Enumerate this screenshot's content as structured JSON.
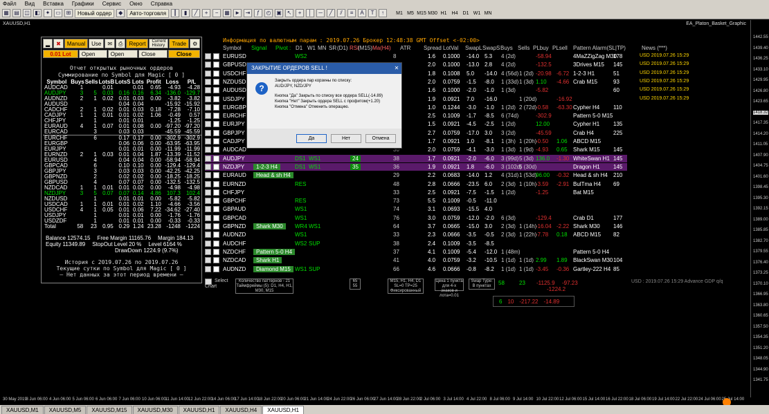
{
  "menu": [
    "Файл",
    "Вид",
    "Вставка",
    "Графики",
    "Сервис",
    "Окно",
    "Справка"
  ],
  "toolbar": {
    "new_order": "Новый ордер",
    "autotrade": "Авто-торговля",
    "timeframes": [
      "M1",
      "M5",
      "M15",
      "M30",
      "H1",
      "H4",
      "D1",
      "W1",
      "MN"
    ]
  },
  "chart": {
    "title": "XAUUSD,H1",
    "ea": "EA_Platon_Basket_Graphic"
  },
  "left_panel": {
    "buttons": [
      "Manual",
      "Use",
      "Report",
      "Current History",
      "Trade"
    ],
    "lot": "0.01 Lot",
    "open_buy": "Open BUY",
    "open_sell": "Open SELL",
    "close_buy": "Close BUY",
    "close_sell": "Close SELL",
    "title1": "Отчет открытых рыночных ордеров",
    "title2": "Суммирование по Symbol для Magic [ 0 ]",
    "headers": [
      "Symbol",
      "Buys",
      "Sells",
      "LotsB",
      "LotsS",
      "Lots",
      "Profit",
      "Loss",
      "P/L"
    ],
    "rows": [
      [
        "AUDCAD",
        "1",
        "",
        "0.01",
        "",
        "0.01",
        "0.65",
        "-4.93",
        "-4.28"
      ],
      [
        "AUDJPY",
        "3",
        "5",
        "0.03",
        "0.16",
        "0.16",
        "6.34",
        "-136.0",
        "-129.7"
      ],
      [
        "AUDNZD",
        "2",
        "1",
        "0.02",
        "0.01",
        "0.03",
        "0.00",
        "-3.82",
        "-3.82"
      ],
      [
        "AUDUSD",
        "",
        "",
        "",
        "0.04",
        "0.04",
        "",
        "-15.92",
        "-15.92"
      ],
      [
        "CADCHF",
        "2",
        "1",
        "0.02",
        "0.01",
        "0.03",
        "0.18",
        "-7.28",
        "-7.10"
      ],
      [
        "CADJPY",
        "1",
        "1",
        "0.01",
        "0.01",
        "0.02",
        "1.06",
        "-0.49",
        "0.57"
      ],
      [
        "CHFJPY",
        "",
        "1",
        "",
        "0.01",
        "0.01",
        "",
        "-1.25",
        "-1.25"
      ],
      [
        "EURAUD",
        "4",
        "1",
        "0.07",
        "0.01",
        "0.08",
        "0.00",
        "-97.20",
        "-97.20"
      ],
      [
        "EURCAD",
        "",
        "3",
        "",
        "0.03",
        "0.03",
        "",
        "-45.59",
        "-45.59"
      ],
      [
        "EURCHF",
        "",
        "6",
        "",
        "0.17",
        "0.17",
        "0.00",
        "-302.9",
        "-302.9"
      ],
      [
        "EURGBP",
        "",
        "",
        "",
        "0.06",
        "0.06",
        "0.00",
        "-63.95",
        "-63.95"
      ],
      [
        "EURJPY",
        "",
        "",
        "",
        "0.01",
        "0.01",
        "0.00",
        "-11.99",
        "-11.99"
      ],
      [
        "EURNZD",
        "2",
        "1",
        "0.03",
        "0.01",
        "0.04",
        "1.87",
        "-13.39",
        "-11.52"
      ],
      [
        "EURUSD",
        "",
        "4",
        "",
        "0.04",
        "0.04",
        "0.00",
        "-58.94",
        "-58.94"
      ],
      [
        "GBPCAD",
        "",
        "6",
        "",
        "0.10",
        "0.10",
        "0.00",
        "-129.4",
        "-129.4"
      ],
      [
        "GBPJPY",
        "",
        "3",
        "",
        "0.03",
        "0.03",
        "0.00",
        "-42.25",
        "-42.25"
      ],
      [
        "GBPNZD",
        "",
        "2",
        "",
        "0.02",
        "0.02",
        "0.00",
        "-18.25",
        "-18.25"
      ],
      [
        "GBPUSD",
        "",
        "4",
        "",
        "0.07",
        "0.07",
        "0.00",
        "-132.5",
        "-132.5"
      ],
      [
        "NZDCAD",
        "1",
        "1",
        "0.01",
        "0.01",
        "0.02",
        "0.00",
        "-4.98",
        "-4.98"
      ],
      [
        "NZDJPY",
        "3",
        "5",
        "0.07",
        "0.07",
        "0.14",
        "4.86",
        "107.3",
        "102.4"
      ],
      [
        "NZDUSD",
        "",
        "1",
        "",
        "0.01",
        "0.01",
        "0.00",
        "-5.82",
        "-5.82"
      ],
      [
        "USDCAD",
        "1",
        "1",
        "0.01",
        "0.01",
        "0.02",
        "1.10",
        "-4.66",
        "-3.56"
      ],
      [
        "USDCHF",
        "4",
        "1",
        "0.05",
        "0.01",
        "0.06",
        "7.22",
        "-34.62",
        "-27.40"
      ],
      [
        "USDJPY",
        "",
        "1",
        "",
        "0.01",
        "0.01",
        "0.00",
        "-1.76",
        "-1.76"
      ],
      [
        "USDZDF",
        "",
        "1",
        "",
        "0.01",
        "0.01",
        "0.00",
        "-0.33",
        "-0.33"
      ],
      [
        "Total",
        "58",
        "23",
        "0.95",
        "0.29",
        "1.24",
        "23.28",
        "-1248",
        "-1224"
      ]
    ],
    "green_rows": [
      1,
      19
    ],
    "balance": "Balance 12574.15",
    "free_margin": "Free Margin 11165.76",
    "margin": "Margin 184.13",
    "equity": "Equity 11349.89",
    "stopout": "StopOut Level 20 %",
    "level": "Level 6164 %",
    "drawdown": "DrawDown 1224.9 (9.7%)",
    "hist1": "История с 2019.07.26 по 2019.07.26",
    "hist2": "Текущие сутки по Symbol для Magic [ 0 ]",
    "hist3": "— Нет данных за этот период времени —"
  },
  "info": {
    "line": "Информация по валютным парам : 2019.07.26   Брокер 12:48:38  GMT Offset <-02:00>"
  },
  "grid_headers": [
    "Symbol",
    "Signal",
    "Pivot :",
    "D1",
    "W1",
    "MN",
    "SR",
    "(D1)",
    "RSI",
    "(M15)",
    "Ma(H4)",
    "ATR",
    "Spread",
    "LotVal",
    "SwapL",
    "SwapS",
    "Buys",
    "Sells",
    "PLbuy",
    "PLsell",
    "Pattern Alarm(SL|TP)",
    "News (***)"
  ],
  "grid_rows": [
    {
      "sym": "EURUSD",
      "sig": "",
      "d1": "WS2",
      "atr": "8",
      "spread": "1.6",
      "lotval": "0.1000",
      "swapl": "-14.0",
      "swaps": "5.3",
      "buys": "4 (2d)",
      "sells": "",
      "plb": "-58.94",
      "pls": "",
      "pat": "4MaZZigZag M30",
      "num": "178",
      "news": "USD 2019.07.26 15:29"
    },
    {
      "sym": "GBPUSD",
      "d1": "",
      "atr": "27",
      "spread": "2.0",
      "lotval": "0.1000",
      "swapl": "-13.0",
      "swaps": "2.8",
      "buys": "4 (2d)",
      "plb": "-132.5",
      "pat": "3Drives M15",
      "num": "145",
      "news": "USD 2019.07.26 15:29"
    },
    {
      "sym": "USDCHF",
      "d1": "",
      "atr": "18",
      "spread": "1.8",
      "lotval": "0.1008",
      "swapl": "5.0",
      "swaps": "-14.0",
      "buys": "4 (56d)",
      "sells": "1 (2d)",
      "plb": "-20.98",
      "pls": "-6.72",
      "pat": "1-2-3 H1",
      "num": "51",
      "news": "USD 2019.07.26 15:29"
    },
    {
      "sym": "NZDUSD",
      "d1": "",
      "atr": "57",
      "spread": "2.0",
      "lotval": "0.0759",
      "swapl": "-1.5",
      "swaps": "-8.0",
      "buys": "1 (33d)",
      "sells": "1 (3d)",
      "plb": "1.10",
      "pls": "-4.66",
      "pat": "Crab M15",
      "num": "93",
      "news": "USD 2019.07.26 15:29"
    },
    {
      "sym": "AUDUSD",
      "d1": "",
      "atr": "18",
      "spread": "1.6",
      "lotval": "0.1000",
      "swapl": "-2.0",
      "swaps": "-1.0",
      "buys": "1 (3d)",
      "plb": "-5.82",
      "pat": "",
      "num": "60",
      "news": "USD 2019.07.26 15:29"
    },
    {
      "sym": "USDJPY",
      "d1": "",
      "atr": "48",
      "spread": "1.9",
      "lotval": "0.0921",
      "swapl": "7.0",
      "swaps": "-16.0",
      "buys": "",
      "sells": "1 (20d)",
      "plb": "",
      "pls": "-16.92",
      "pat": "",
      "num": "",
      "news": "USD 2019.07.26 15:29"
    },
    {
      "sym": "EURGBP",
      "d1": "",
      "atr": "40",
      "spread": "1.0",
      "lotval": "0.1244",
      "swapl": "-3.0",
      "swaps": "-1.0",
      "buys": "1 (2d)",
      "sells": "2 (72d)",
      "plb": "-0.58",
      "pls": "-63.30",
      "pat": "Cypher H4",
      "num": "110",
      "news": ""
    },
    {
      "sym": "EURCHF",
      "d1": "",
      "atr": "19",
      "spread": "2.5",
      "lotval": "0.1009",
      "swapl": "-1.7",
      "swaps": "-8.5",
      "buys": "6 (74d)",
      "plb": "-302.9",
      "pat": "Pattern 5-0 M15",
      "num": "",
      "news": ""
    },
    {
      "sym": "EURJPY",
      "d1": "",
      "atr": "53",
      "spread": "1.5",
      "lotval": "0.0921",
      "swapl": "-4.5",
      "swaps": "-2.5",
      "buys": "1 (2d)",
      "plb": "12.00",
      "pat": "Cypher H1",
      "num": "135",
      "news": ""
    },
    {
      "sym": "GBPJPY",
      "d1": "",
      "atr": "86",
      "spread": "2.7",
      "lotval": "0.0759",
      "swapl": "-17.0",
      "swaps": "3.0",
      "buys": "3 (2d)",
      "plb": "-45.59",
      "pat": "Crab H4",
      "num": "225",
      "news": ""
    },
    {
      "sym": "CADJPY",
      "d1": "",
      "atr": "85",
      "spread": "1.7",
      "lotval": "0.0921",
      "swapl": "1.0",
      "swaps": "-8.1",
      "buys": "1 (3h)",
      "sells": "1 (20h)",
      "plb": "-0.50",
      "pls": "1.06",
      "pat": "ABCD M15",
      "num": "",
      "news": ""
    },
    {
      "sym": "AUDCAD",
      "d1": "",
      "atr": "30",
      "spread": "2.0",
      "lotval": "0.0759",
      "swapl": "-4.1",
      "swaps": "-3.0",
      "buys": "1 (3d)",
      "sells": "1 (9d)",
      "plb": "-4.93",
      "pls": "0.65",
      "pat": "Shark M15",
      "num": "145",
      "news": ""
    },
    {
      "sym": "AUDJPY",
      "d1": "DS1",
      "w1": "WS1",
      "rsi": "24",
      "atr": "38",
      "spread": "1.7",
      "lotval": "0.0921",
      "swapl": "-2.0",
      "swaps": "-6.0",
      "buys": "3 (99d)",
      "sells": "5 (3d)",
      "plb": "136.0",
      "pls": "-1.30",
      "pat": "WhiteSwan H1",
      "num": "145",
      "hl": "p"
    },
    {
      "sym": "NZDJPY",
      "sig": "1-2-3 H4",
      "d1": "DS1",
      "w1": "WS1",
      "rsi": "35",
      "atr": "36",
      "spread": "1.9",
      "lotval": "0.0921",
      "swapl": "1.8",
      "swaps": "-6.0",
      "buys": "3 (102d)",
      "sells": "5 (30d)",
      "plb": "",
      "pls": "",
      "pat": "Dragon H1",
      "num": "145",
      "hl": "p"
    },
    {
      "sym": "EURAUD",
      "sig": "Head & sh H4",
      "d1": "",
      "atr": "29",
      "spread": "2.2",
      "lotval": "0.0683",
      "swapl": "-14.0",
      "swaps": "1.2",
      "buys": "4 (31d)",
      "sells": "1 (53d)",
      "plb": "96.00",
      "pls": "-0.32",
      "pat": "Head & sh H4",
      "num": "210"
    },
    {
      "sym": "EURNZD",
      "d1": "RES",
      "atr": "48",
      "spread": "2.8",
      "lotval": "0.0666",
      "swapl": "-23.5",
      "swaps": "6.0",
      "buys": "2 (3d)",
      "sells": "1 (10h)",
      "plb": "-3.59",
      "pls": "-2.91",
      "pat": "BulTma H4",
      "num": "69"
    },
    {
      "sym": "CHFJPY",
      "d1": "",
      "atr": "33",
      "spread": "2.5",
      "lotval": "0.0921",
      "swapl": "-7.5",
      "swaps": "-1.5",
      "buys": "1 (2d)",
      "plb": "-1.25",
      "pat": "Bat M15",
      "num": ""
    },
    {
      "sym": "GBPCHF",
      "d1": "RES",
      "atr": "73",
      "spread": "5.5",
      "lotval": "0.1009",
      "swapl": "-0.5",
      "swaps": "-11.0",
      "buys": "",
      "plb": "",
      "pat": "",
      "num": ""
    },
    {
      "sym": "GBPAUD",
      "d1": "WS1",
      "atr": "74",
      "spread": "3.1",
      "lotval": "0.0693",
      "swapl": "-15.5",
      "swaps": "4.0",
      "buys": "",
      "plb": "",
      "pat": "",
      "num": ""
    },
    {
      "sym": "GBPCAD",
      "d1": "WS1",
      "atr": "76",
      "spread": "3.0",
      "lotval": "0.0759",
      "swapl": "-12.0",
      "swaps": "-2.0",
      "buys": "6 (3d)",
      "plb": "-129.4",
      "pat": "Crab D1",
      "num": "177"
    },
    {
      "sym": "GBPNZD",
      "sig": "Shark M30",
      "d1": "WR4",
      "w1": "WS1",
      "atr": "64",
      "spread": "3.7",
      "lotval": "0.0665",
      "swapl": "-15.0",
      "swaps": "3.0",
      "buys": "2 (3d)",
      "sells": "1 (14h)",
      "plb": "-16.04",
      "pls": "-2.22",
      "pat": "Shark M30",
      "num": "146"
    },
    {
      "sym": "AUDNZD",
      "d1": "WS1",
      "atr": "33",
      "spread": "2.3",
      "lotval": "0.0666",
      "swapl": "-3.5",
      "swaps": "-0.5",
      "buys": "2 (3d)",
      "sells": "1 (22h)",
      "plb": "-7.78",
      "pls": "0.18",
      "pat": "ABCD M15",
      "num": "82"
    },
    {
      "sym": "AUDCHF",
      "d1": "WS2",
      "w1": "SUP",
      "atr": "38",
      "spread": "2.4",
      "lotval": "0.1009",
      "swapl": "-3.5",
      "swaps": "-8.5",
      "buys": "",
      "plb": "",
      "pat": "",
      "num": ""
    },
    {
      "sym": "NZDCHF",
      "sig": "Pattern 5-0 H4",
      "d1": "",
      "atr": "37",
      "spread": "4.1",
      "lotval": "0.1009",
      "swapl": "-5.4",
      "swaps": "-12.0",
      "buys": "1 (48m)",
      "plb": "",
      "pat": "Pattern 5-0 H4",
      "num": "",
      "news": ""
    },
    {
      "sym": "NZDCAD",
      "sig": "Shark H1",
      "d1": "",
      "atr": "41",
      "spread": "4.0",
      "lotval": "0.0759",
      "swapl": "-3.2",
      "swaps": "-10.5",
      "buys": "1 (1d)",
      "sells": "1 (1d)",
      "plb": "2.99",
      "pls": "1.89",
      "pat": "BlackSwan M30",
      "num": "104"
    },
    {
      "sym": "AUDNZD",
      "sig": "Diamond M15",
      "d1": "WS1",
      "w1": "SUP",
      "atr": "66",
      "spread": "4.6",
      "lotval": "0.0666",
      "swapl": "-0.8",
      "swaps": "-8.2",
      "buys": "1 (1d)",
      "sells": "1 (1d)",
      "plb": "-3.45",
      "pls": "-0.36",
      "pat": "Gartley-222 H4",
      "num": "85"
    }
  ],
  "totals": {
    "buys": "58",
    "sells": "23",
    "plb": "-1125.9",
    "pls": "-97.23",
    "total": "-1224.2",
    "row2_a": "6",
    "row2_b": "10",
    "row2_c": "-217.22",
    "row2_d": "-14.89"
  },
  "footer": {
    "select": "Select",
    "chart": "Chart",
    "gdp": "USD : 2019.07.26 15:29  Advance GDP q/q",
    "box1": "Количество паттернов - 21 Таймфреймы (5): D1, H4, H1, M30, M15",
    "box2": "65 55",
    "box3": "M15, H1, H4, D1 SL=0  TP=25 Фиксированный",
    "box4": "Цена 1 пункта для 4-х знаков и лота=0.01",
    "box5": "Swap Type: В пунктах"
  },
  "dialog": {
    "title": "ЗАКРЫТИЕ ОРДЕРОВ SELL !",
    "line1": "Закрыть ордера пар корзины по списку:",
    "line2": "AUD/JPY, NZD/JPY",
    "line3": "Кнопка \"Да\" Закрыть по списку все ордера SELL(-14.89)",
    "line4": "Кнопка \"Нет\" Закрыть ордера SELL с профитом(+1.20)",
    "line5": "Кнопка \"Отмена\" Отменить операцию.",
    "yes": "Да",
    "no": "Нет",
    "cancel": "Отмена"
  },
  "tabs": [
    "XAUUSD,M1",
    "XAUUSD,M5",
    "XAUUSD,M15",
    "XAUUSD,M30",
    "XAUUSD,H1",
    "XAUUSD,H4",
    "XAUUSD,H1"
  ],
  "price_axis": [
    "1442.55",
    "1439.40",
    "1436.25",
    "1433.10",
    "1429.95",
    "1426.80",
    "1423.65",
    "1418.32",
    "1417.35",
    "1414.20",
    "1411.05",
    "1407.90",
    "1404.75",
    "1401.60",
    "1398.45",
    "1395.30",
    "1392.15",
    "1389.00",
    "1385.85",
    "1382.70",
    "1379.55",
    "1376.40",
    "1373.25",
    "1370.10",
    "1366.95",
    "1363.80",
    "1360.65",
    "1357.50",
    "1354.35",
    "1351.20",
    "1348.05",
    "1344.90",
    "1341.75"
  ],
  "time_axis": [
    "30 May 2019",
    "3 Jun 06:00",
    "4 Jun 06:00",
    "5 Jun 06:00",
    "6 Jun 06:00",
    "7 Jun 06:00",
    "10 Jun 06:00",
    "11 Jun 14:00",
    "12 Jun 22:00",
    "14 Jun 06:00",
    "17 Jun 14:00",
    "18 Jun 22:00",
    "20 Jun 06:00",
    "21 Jun 14:00",
    "24 Jun 22:00",
    "26 Jun 06:00",
    "27 Jun 14:00",
    "28 Jun 22:00",
    "2 Jul 06:00",
    "3 Jul 14:00",
    "4 Jul 22:00",
    "8 Jul 06:00",
    "9 Jul 14:00",
    "10 Jul 22:00",
    "12 Jul 06:00",
    "15 Jul 14:00",
    "16 Jul 22:00",
    "18 Jul 06:00",
    "19 Jul 14:00",
    "22 Jul 22:00",
    "24 Jul 06:00",
    "25 Jul 14:00"
  ]
}
